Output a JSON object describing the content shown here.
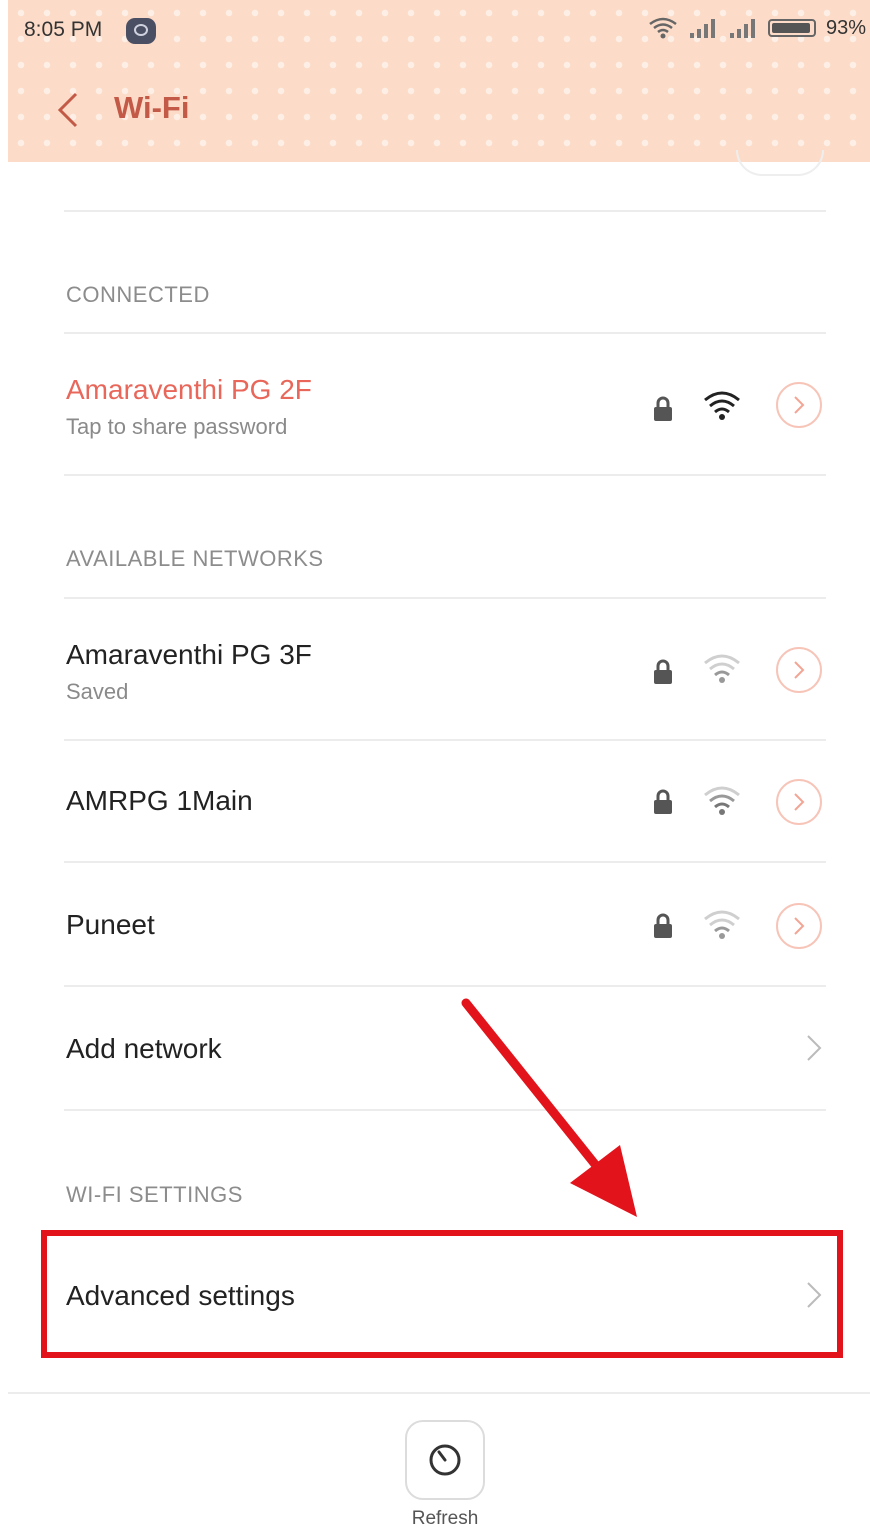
{
  "status_bar": {
    "time": "8:05 PM",
    "battery": "93%"
  },
  "header": {
    "title": "Wi-Fi"
  },
  "sections": {
    "connected": "CONNECTED",
    "available": "AVAILABLE NETWORKS",
    "settings": "WI-FI SETTINGS"
  },
  "connected_network": {
    "name": "Amaraventhi PG 2F",
    "subtitle": "Tap to share password"
  },
  "available_networks": [
    {
      "name": "Amaraventhi PG 3F",
      "subtitle": "Saved"
    },
    {
      "name": "AMRPG 1Main",
      "subtitle": ""
    },
    {
      "name": "Puneet",
      "subtitle": ""
    }
  ],
  "add_network": "Add network",
  "advanced_settings": "Advanced settings",
  "refresh": "Refresh",
  "colors": {
    "accent": "#e8675a",
    "header_bg": "#fcdcc8",
    "title": "#c35a47",
    "highlight": "#e3131b"
  },
  "icons": [
    "back-arrow-icon",
    "lock-icon",
    "wifi-signal-icon",
    "chevron-right-icon",
    "refresh-icon"
  ]
}
